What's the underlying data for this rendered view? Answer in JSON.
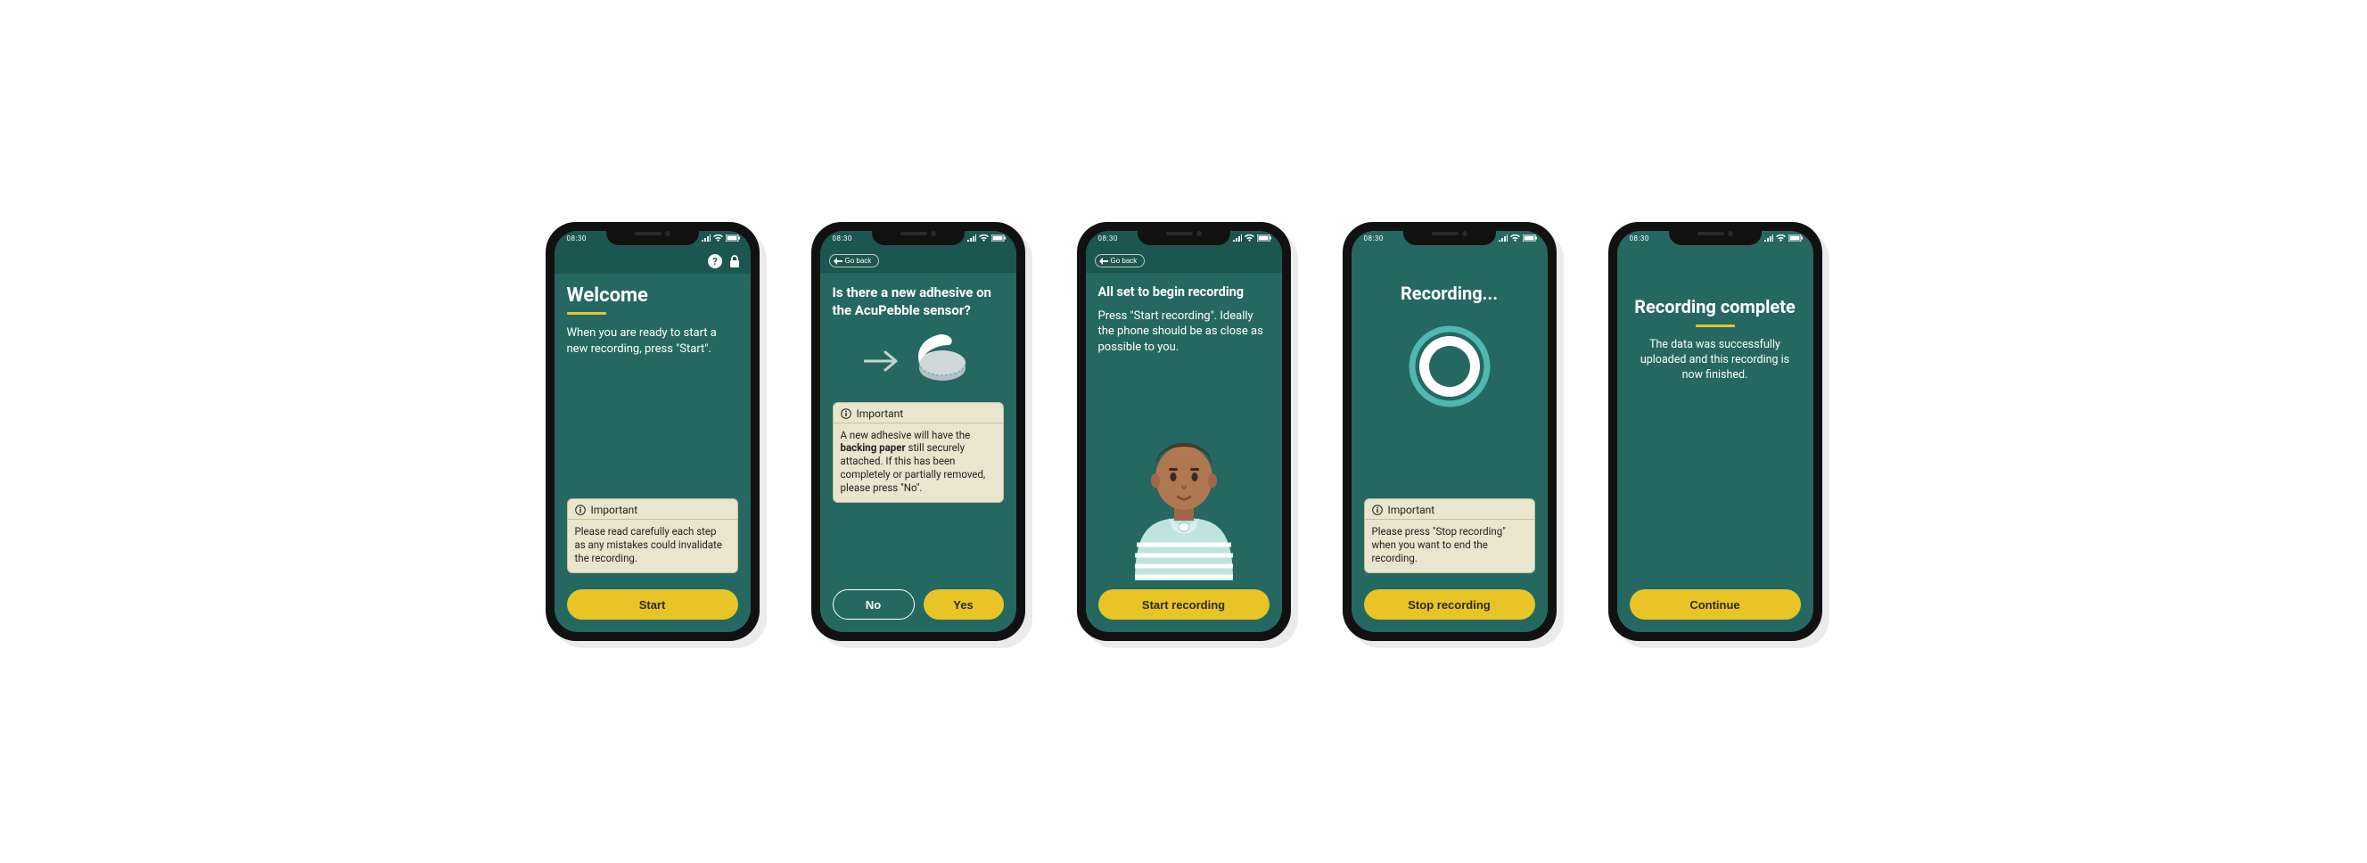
{
  "status_time": "08:30",
  "go_back_label": "Go back",
  "important_label": "Important",
  "screens": {
    "welcome": {
      "title": "Welcome",
      "body": "When you are ready to start a new recording, press \"Start\".",
      "important": "Please read carefully each step as any mistakes could invalidate the recording.",
      "primary_btn": "Start"
    },
    "adhesive": {
      "title": "Is there a new adhesive on the AcuPebble sensor?",
      "important_pre": "A new adhesive will have the ",
      "important_bold": "backing paper",
      "important_post": " still securely attached. If this has been completely or partially removed, please press \"No\".",
      "no_btn": "No",
      "yes_btn": "Yes"
    },
    "ready": {
      "title": "All set to begin recording",
      "body": "Press \"Start recording\". Ideally the phone should be as close as possible to you.",
      "primary_btn": "Start recording"
    },
    "recording": {
      "title": "Recording...",
      "important": "Please press \"Stop recording\" when you want to end the recording.",
      "primary_btn": "Stop recording"
    },
    "complete": {
      "title": "Recording complete",
      "body": "The data was successfully uploaded and this recording is now finished.",
      "primary_btn": "Continue"
    }
  }
}
